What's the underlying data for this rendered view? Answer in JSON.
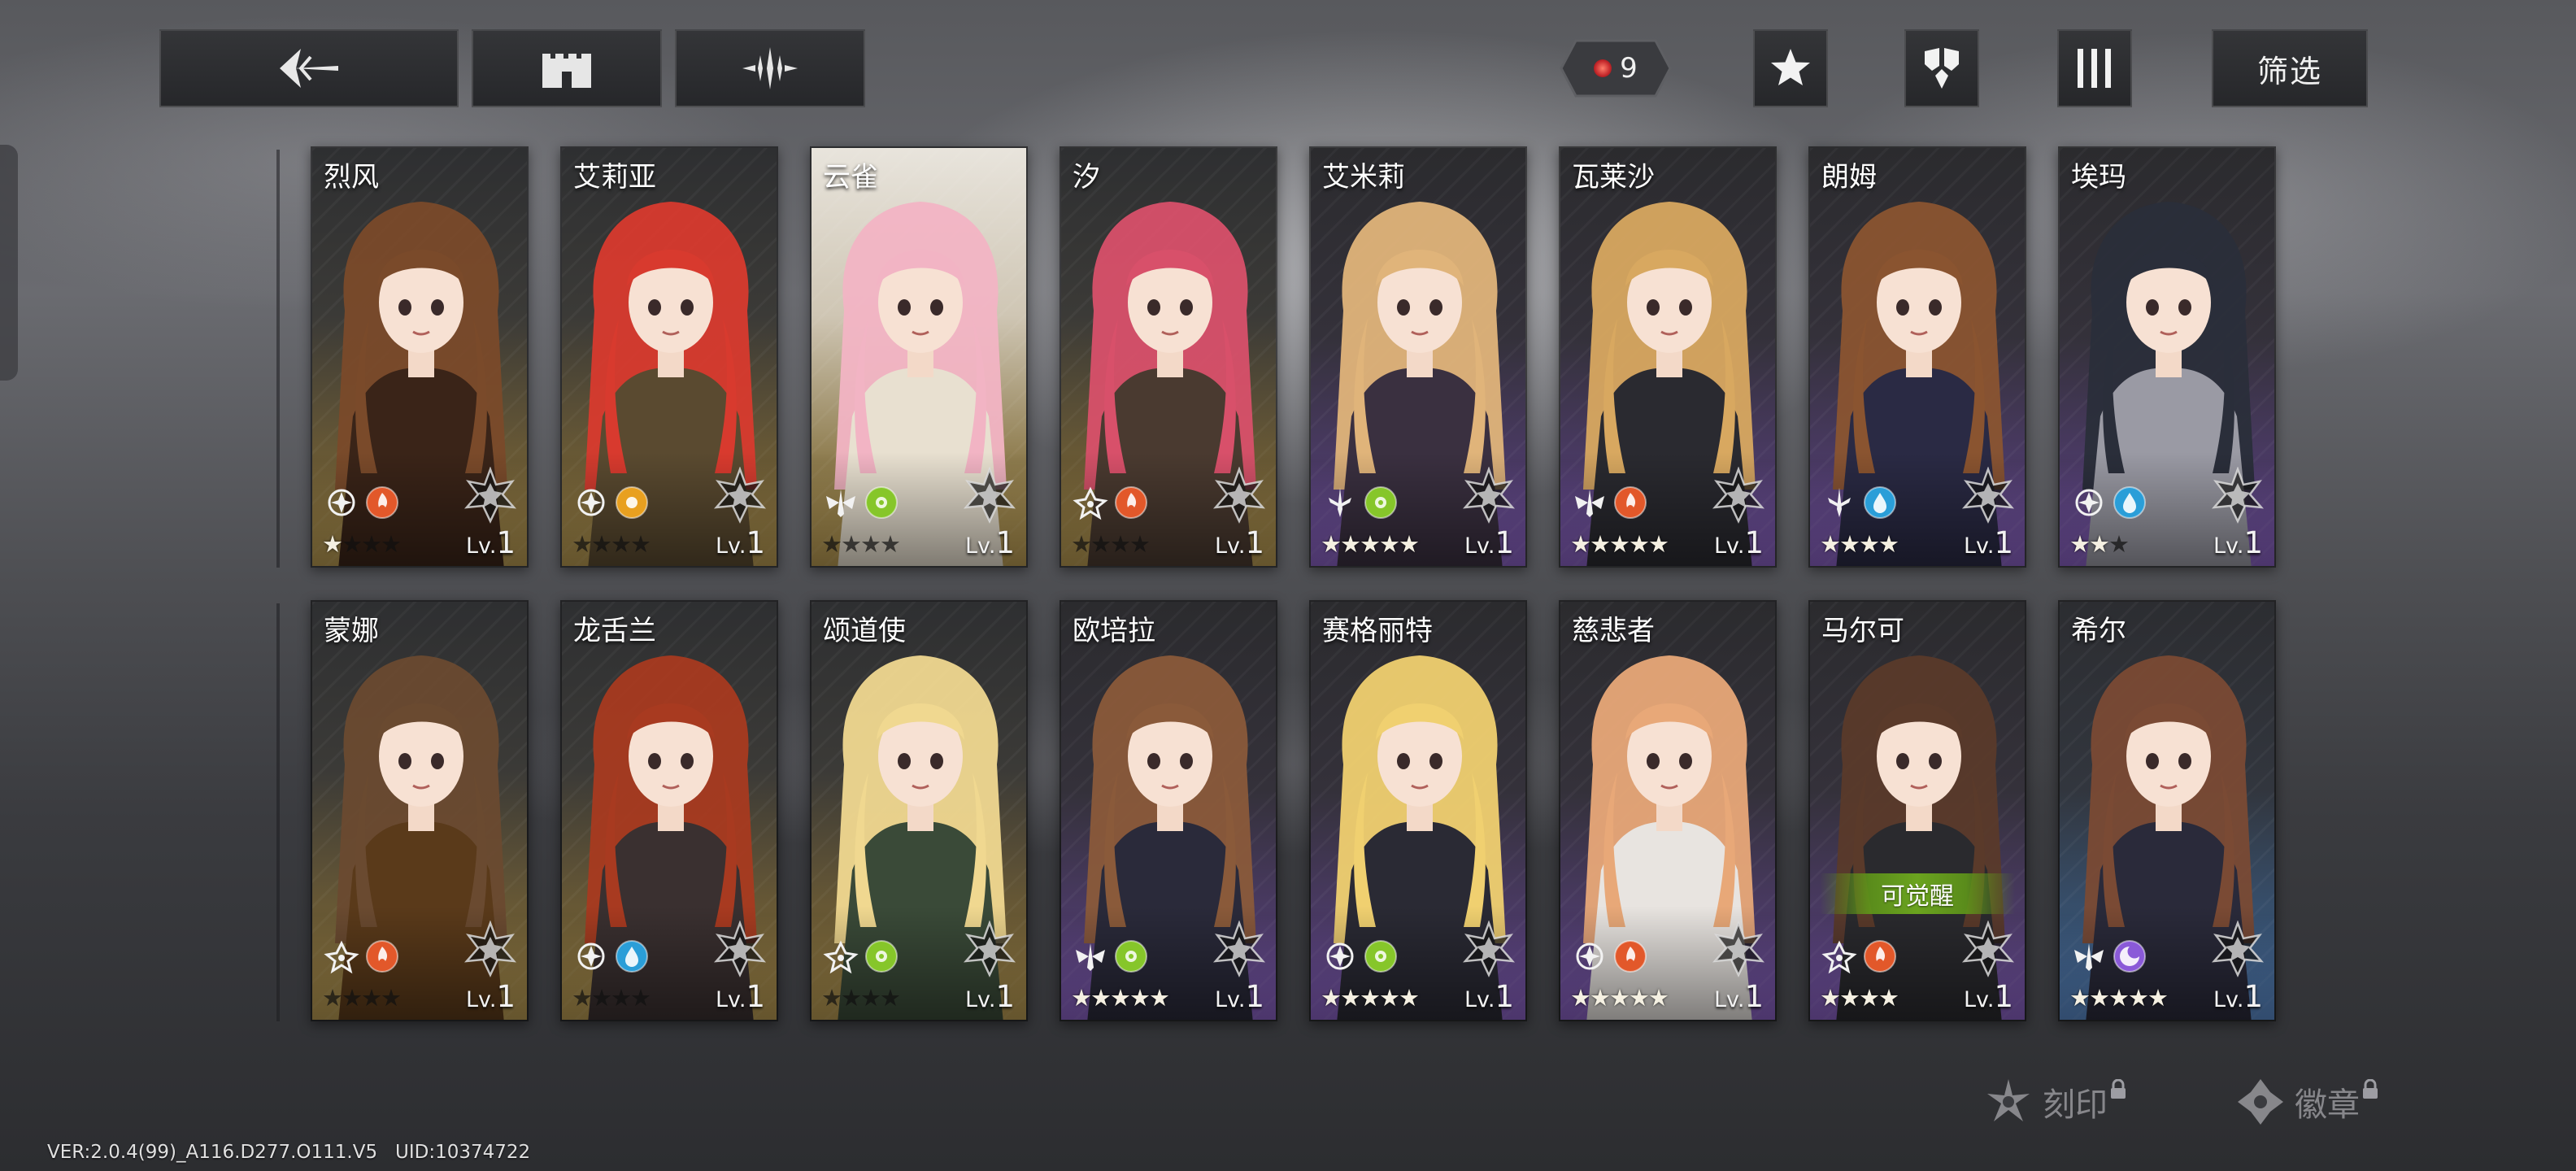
{
  "toolbar": {
    "back_icon": "back-arrow-icon",
    "castle_icon": "castle-icon",
    "fork_icon": "tuning-fork-icon",
    "resource_count": "9",
    "star_icon": "star-icon",
    "class_icon": "class-icon",
    "columns_icon": "columns-icon",
    "filter_label": "筛选"
  },
  "rows": [
    [
      {
        "name": "烈风",
        "stars": 1,
        "max_stars": 4,
        "level_prefix": "Lv.",
        "level": "1",
        "theme": "gold",
        "element1": "faction-white",
        "element2": "fire",
        "hair": "#7a4a2a",
        "outfit": "#3a2418"
      },
      {
        "name": "艾莉亚",
        "stars": 0,
        "max_stars": 4,
        "level_prefix": "Lv.",
        "level": "1",
        "theme": "gold",
        "element1": "faction-white",
        "element2": "sun",
        "hair": "#d83a2e",
        "outfit": "#5a4a30"
      },
      {
        "name": "云雀",
        "stars": 0,
        "max_stars": 4,
        "level_prefix": "Lv.",
        "level": "1",
        "theme": "gold-light",
        "element1": "faction-wing",
        "element2": "poison",
        "hair": "#f2b4c4",
        "outfit": "#e8e0d0"
      },
      {
        "name": "汐",
        "stars": 0,
        "max_stars": 4,
        "level_prefix": "Lv.",
        "level": "1",
        "theme": "gold",
        "element1": "faction-crest",
        "element2": "fire",
        "hair": "#d8506a",
        "outfit": "#4a3a30"
      },
      {
        "name": "艾米莉",
        "stars": 5,
        "max_stars": 5,
        "level_prefix": "Lv.",
        "level": "1",
        "theme": "purple",
        "element1": "faction-sword",
        "element2": "poison",
        "hair": "#e0b47a",
        "outfit": "#3a3040"
      },
      {
        "name": "瓦莱沙",
        "stars": 5,
        "max_stars": 5,
        "level_prefix": "Lv.",
        "level": "1",
        "theme": "purple",
        "element1": "faction-wing",
        "element2": "fire",
        "hair": "#d8a860",
        "outfit": "#2a2a30"
      },
      {
        "name": "朗姆",
        "stars": 4,
        "max_stars": 4,
        "level_prefix": "Lv.",
        "level": "1",
        "theme": "purple",
        "element1": "faction-sword",
        "element2": "water",
        "hair": "#8a5430",
        "outfit": "#2a2a44"
      },
      {
        "name": "埃玛",
        "stars": 2,
        "max_stars": 3,
        "level_prefix": "Lv.",
        "level": "1",
        "theme": "purple",
        "element1": "faction-white",
        "element2": "water",
        "hair": "#2a2e3a",
        "outfit": "#9a9aa4"
      }
    ],
    [
      {
        "name": "蒙娜",
        "stars": 0,
        "max_stars": 4,
        "level_prefix": "Lv.",
        "level": "1",
        "theme": "gold",
        "element1": "faction-crest",
        "element2": "fire",
        "hair": "#6a4a30",
        "outfit": "#5a3a1a"
      },
      {
        "name": "龙舌兰",
        "stars": 0,
        "max_stars": 4,
        "level_prefix": "Lv.",
        "level": "1",
        "theme": "gold",
        "element1": "faction-white",
        "element2": "water",
        "hair": "#a83a20",
        "outfit": "#3a3030"
      },
      {
        "name": "颂道使",
        "stars": 0,
        "max_stars": 4,
        "level_prefix": "Lv.",
        "level": "1",
        "theme": "gold",
        "element1": "faction-crest",
        "element2": "poison",
        "hair": "#f0d890",
        "outfit": "#3a4a38"
      },
      {
        "name": "欧培拉",
        "stars": 5,
        "max_stars": 5,
        "level_prefix": "Lv.",
        "level": "1",
        "theme": "purple",
        "element1": "faction-wing",
        "element2": "poison",
        "hair": "#8a5a3a",
        "outfit": "#2a2a3a"
      },
      {
        "name": "赛格丽特",
        "stars": 5,
        "max_stars": 5,
        "level_prefix": "Lv.",
        "level": "1",
        "theme": "purple",
        "element1": "faction-white",
        "element2": "poison",
        "hair": "#f0d070",
        "outfit": "#2a2a34"
      },
      {
        "name": "慈悲者",
        "stars": 5,
        "max_stars": 5,
        "level_prefix": "Lv.",
        "level": "1",
        "theme": "purple",
        "element1": "faction-white",
        "element2": "fire",
        "hair": "#e8a878",
        "outfit": "#e8e4e0"
      },
      {
        "name": "马尔可",
        "stars": 4,
        "max_stars": 4,
        "level_prefix": "Lv.",
        "level": "1",
        "theme": "purple",
        "element1": "faction-crest",
        "element2": "fire",
        "hair": "#5a3a2a",
        "outfit": "#2a2a2e",
        "awaken": "可觉醒"
      },
      {
        "name": "希尔",
        "stars": 5,
        "max_stars": 5,
        "level_prefix": "Lv.",
        "level": "1",
        "theme": "blue",
        "element1": "faction-wing",
        "element2": "arcane",
        "hair": "#7a4a34",
        "outfit": "#2a2a3a"
      }
    ]
  ],
  "bottom": {
    "engrave_label": "刻印",
    "badge_label": "徽章"
  },
  "version_text": "VER:2.0.4(99)_A116.D277.O111.V5   UID:10374722",
  "colors": {
    "fire": "#e2582a",
    "water": "#2a9ed8",
    "poison": "#86c62a",
    "sun": "#e8a020",
    "arcane": "#8a5ad8",
    "awaken_green": "#6aa820"
  }
}
